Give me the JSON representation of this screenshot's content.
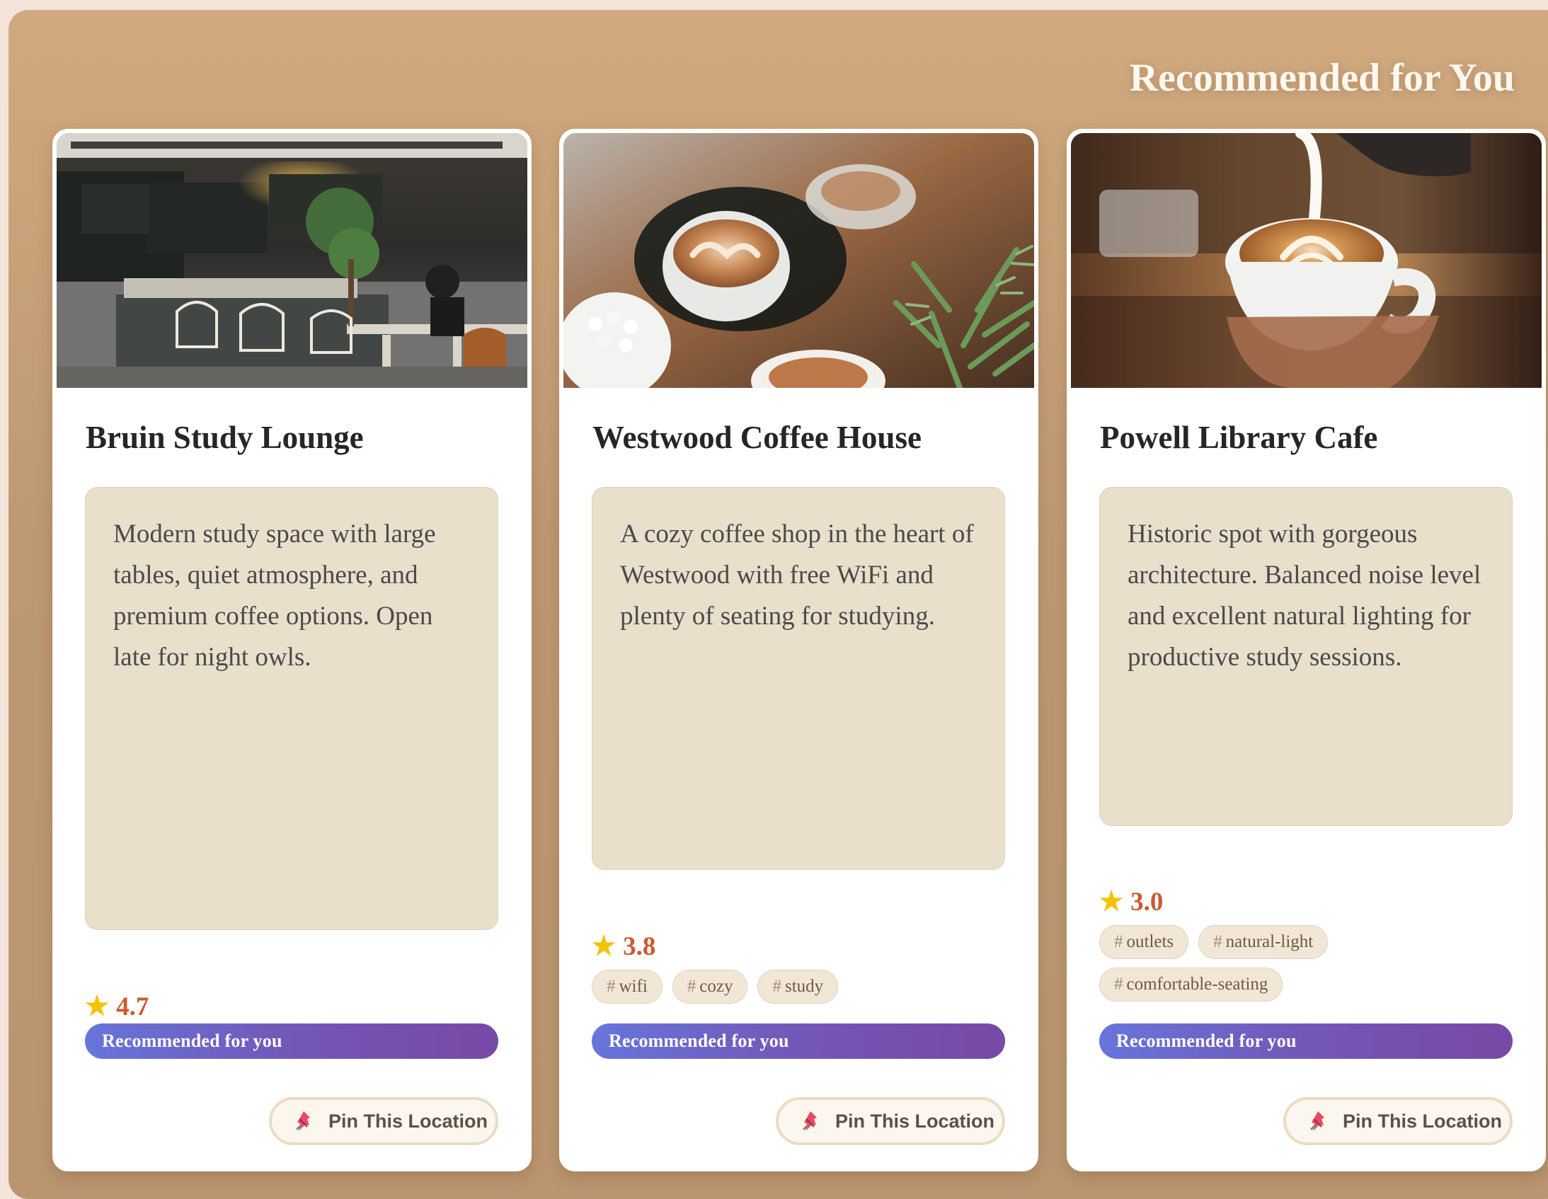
{
  "header": {
    "title": "Recommended for You"
  },
  "cards": [
    {
      "title": "Bruin Study Lounge",
      "description": "Modern study space with large tables, quiet atmosphere, and premium coffee options. Open late for night owls.",
      "rating": "4.7",
      "tags": [],
      "recommendation_label": "Recommended for you",
      "pin_button_label": "Pin This Location",
      "photo_icon": "cafe-interior-photo"
    },
    {
      "title": "Westwood Coffee House",
      "description": "A cozy coffee shop in the heart of Westwood with free WiFi and plenty of seating for studying.",
      "rating": "3.8",
      "tags": [
        "wifi",
        "cozy",
        "study"
      ],
      "recommendation_label": "Recommended for you",
      "pin_button_label": "Pin This Location",
      "photo_icon": "coffee-cups-photo"
    },
    {
      "title": "Powell Library Cafe",
      "description": "Historic spot with gorgeous architecture. Balanced noise level and excellent natural lighting for productive study sessions.",
      "rating": "3.0",
      "tags": [
        "outlets",
        "natural-light",
        "comfortable-seating"
      ],
      "recommendation_label": "Recommended for you",
      "pin_button_label": "Pin This Location",
      "photo_icon": "latte-pour-photo"
    }
  ],
  "icons": {
    "rating": "star-icon",
    "pin": "pin-icon"
  },
  "colors": {
    "panel": "#c8a37a",
    "rating_text": "#cc5a2e",
    "star": "#f2c300",
    "recommendation_gradient_start": "#6775db",
    "recommendation_gradient_end": "#7849a6"
  }
}
